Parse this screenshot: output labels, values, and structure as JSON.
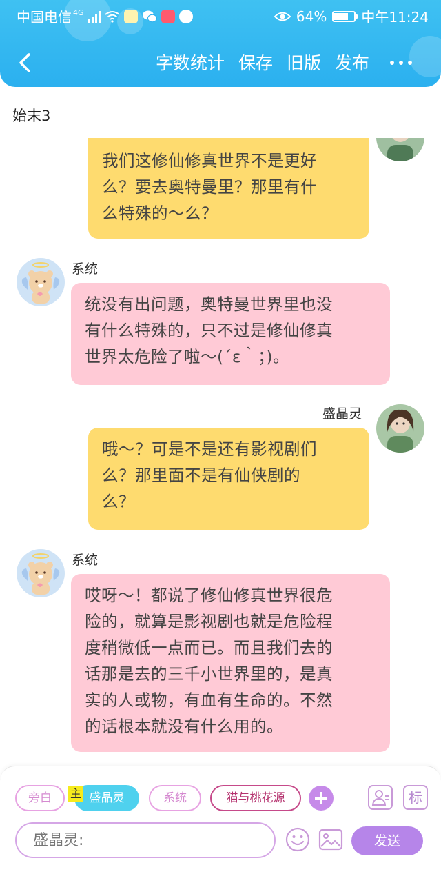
{
  "status_bar": {
    "carrier": "中国电信",
    "network": "4G",
    "battery": "64%",
    "time": "中午11:24"
  },
  "header": {
    "actions": [
      "字数统计",
      "保存",
      "旧版",
      "发布"
    ]
  },
  "chapter_title": "始末3",
  "messages": [
    {
      "sender": "",
      "side": "right",
      "color": "yellow",
      "lines": [
        "我们这修仙修真世界不是更好",
        "么？要去奥特曼里？那里有什",
        "么特殊的～么？"
      ]
    },
    {
      "sender": "系统",
      "side": "left",
      "color": "pink",
      "lines": [
        "统没有出问题，奥特曼世界里也没",
        "有什么特殊的，只不过是修仙修真",
        "世界太危险了啦～(´ε｀；)。"
      ]
    },
    {
      "sender": "盛晶灵",
      "side": "right",
      "color": "yellow",
      "lines": [
        "哦～？可是不是还有影视剧们",
        "么？那里面不是有仙侠剧的",
        "么？"
      ]
    },
    {
      "sender": "系统",
      "side": "left",
      "color": "pink",
      "lines": [
        "哎呀～！都说了修仙修真世界很危",
        "险的，就算是影视剧也就是危险程",
        "度稍微低一点而已。而且我们去的",
        "话那是去的三千小世界里的，是真",
        "实的人或物，有血有生命的。不然",
        "的话根本就没有什么用的。"
      ]
    }
  ],
  "roles": {
    "main_tag": "主",
    "chips": [
      "旁白",
      "盛晶灵",
      "系统",
      "猫与桃花源"
    ],
    "mark_label": "标"
  },
  "composer": {
    "placeholder": "盛晶灵:",
    "send_label": "发送"
  },
  "colors": {
    "header": "#2bb0ef",
    "yellow_bubble": "#fedb6f",
    "pink_bubble": "#ffcad6",
    "send_button": "#b685e9"
  }
}
